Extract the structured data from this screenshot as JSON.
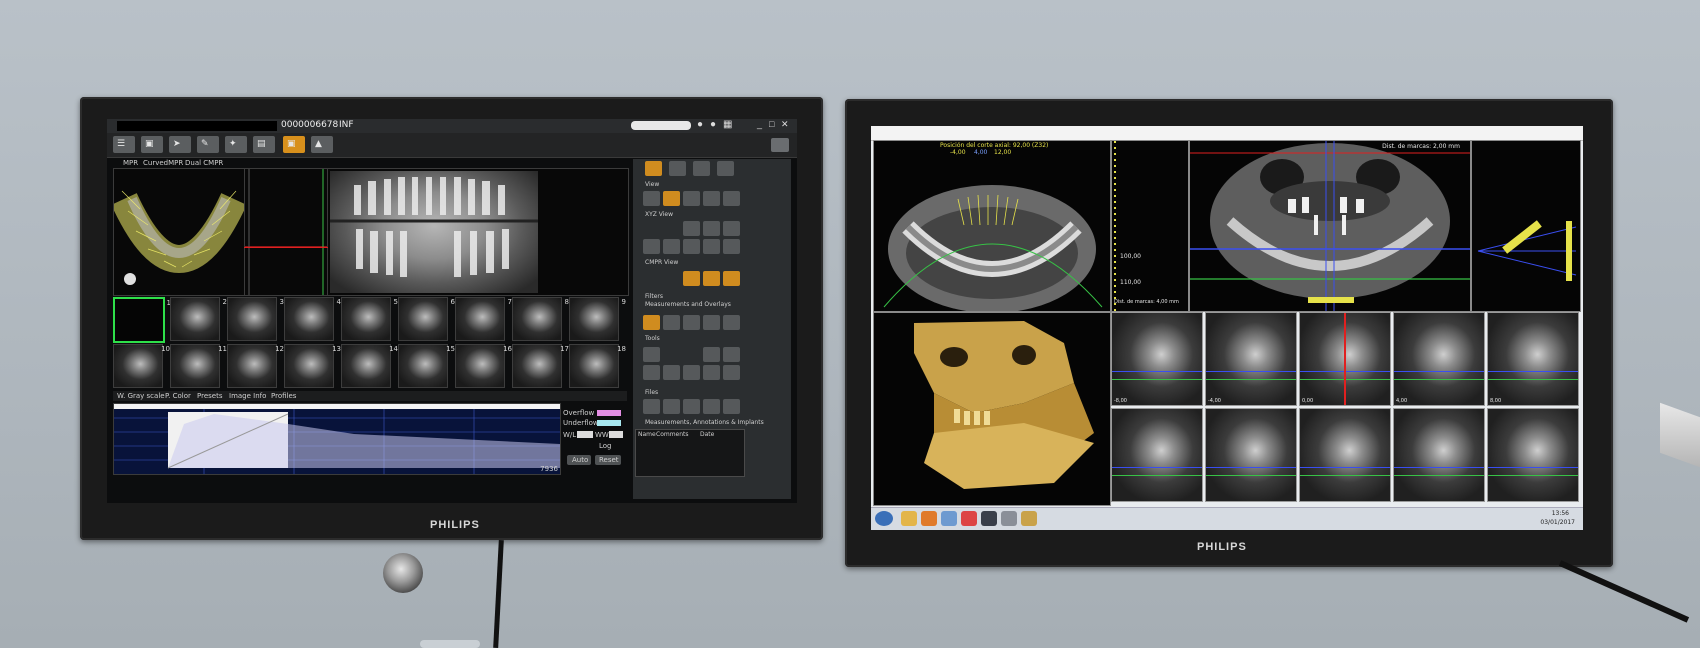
{
  "left_monitor": {
    "brand": "PHILIPS",
    "app": {
      "patient_id": "0000006678",
      "patient_tag": "INF",
      "tabs": [
        "MPR",
        "CurvedMPR",
        "Dual CMPR"
      ],
      "slice_numbers": [
        "1",
        "2",
        "3",
        "4",
        "5",
        "6",
        "7",
        "8",
        "9",
        "10",
        "11",
        "12",
        "13",
        "14",
        "15",
        "16",
        "17",
        "18"
      ],
      "bottom_tabs": [
        "W. Gray scale",
        "P. Color",
        "Presets",
        "Image Info",
        "Profiles"
      ],
      "histogram_max": "7936",
      "overflow_label": "Overflow",
      "underflow_label": "Underflow",
      "wl_label": "W/L",
      "ww_label": "WW",
      "log_label": "Log",
      "auto_button": "Auto",
      "reset_button": "Reset",
      "panel_sections": {
        "view": "View",
        "xyz_view": "XYZ View",
        "cmpr_view": "CMPR View",
        "filters": "Filters",
        "measurements_overlays": "Measurements and Overlays",
        "tools": "Tools",
        "files": "Files",
        "measurements_list": "Measurements, Annotations & Implants"
      },
      "table_headers": [
        "Name",
        "Comments",
        "Date"
      ]
    }
  },
  "right_monitor": {
    "brand": "PHILIPS",
    "app": {
      "axial_caption": "Posición del corte axial: 92,00 (Z32)",
      "axial_values": [
        "-4,00",
        "4,00",
        "12,00"
      ],
      "panoramic_caption": "Dist. de marcas: 2,00 mm",
      "ruler_labels": [
        "100,00",
        "110,00"
      ],
      "ruler_caption": "Dist. de marcas: 4,00 mm",
      "slice_labels": [
        "-8,00",
        "-4,00",
        "0,00",
        "4,00",
        "8,00"
      ],
      "clock": "13:56",
      "date": "03/01/2017"
    }
  },
  "colors": {
    "wall": "#b2bac1",
    "accent_orange": "#d8901c",
    "yellow_overlay": "#e6e24a",
    "red_line": "#e02020",
    "blue_line": "#3a4ef0",
    "green_line": "#37c246",
    "bone": "#c9a24a"
  }
}
